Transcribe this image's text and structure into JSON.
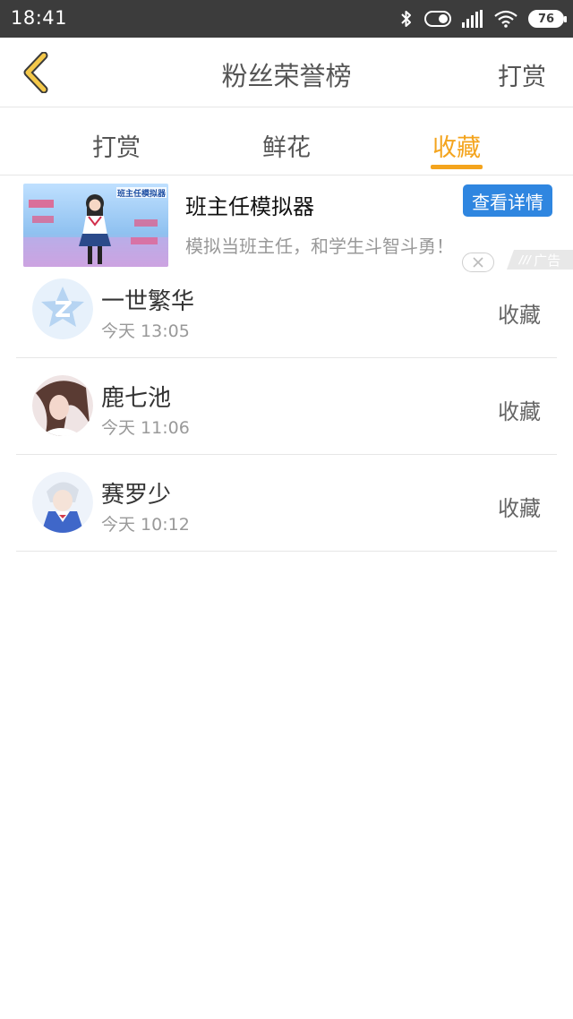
{
  "status_bar": {
    "time": "18:41",
    "battery": "76"
  },
  "header": {
    "title": "粉丝荣誉榜",
    "action_label": "打赏"
  },
  "tabs": [
    {
      "label": "打赏",
      "active": false
    },
    {
      "label": "鲜花",
      "active": false
    },
    {
      "label": "收藏",
      "active": true
    }
  ],
  "accent_color": "#f4a41d",
  "ad": {
    "title": "班主任模拟器",
    "description": "模拟当班主任，和学生斗智斗勇！",
    "button_label": "查看详情",
    "button_color": "#2f86e0",
    "tag": "广告",
    "image_banner": "班主任模拟器"
  },
  "list": [
    {
      "name": "一世繁华",
      "time": "今天 13:05",
      "action": "收藏"
    },
    {
      "name": "鹿七池",
      "time": "今天 11:06",
      "action": "收藏"
    },
    {
      "name": "赛罗少",
      "time": "今天 10:12",
      "action": "收藏"
    }
  ]
}
